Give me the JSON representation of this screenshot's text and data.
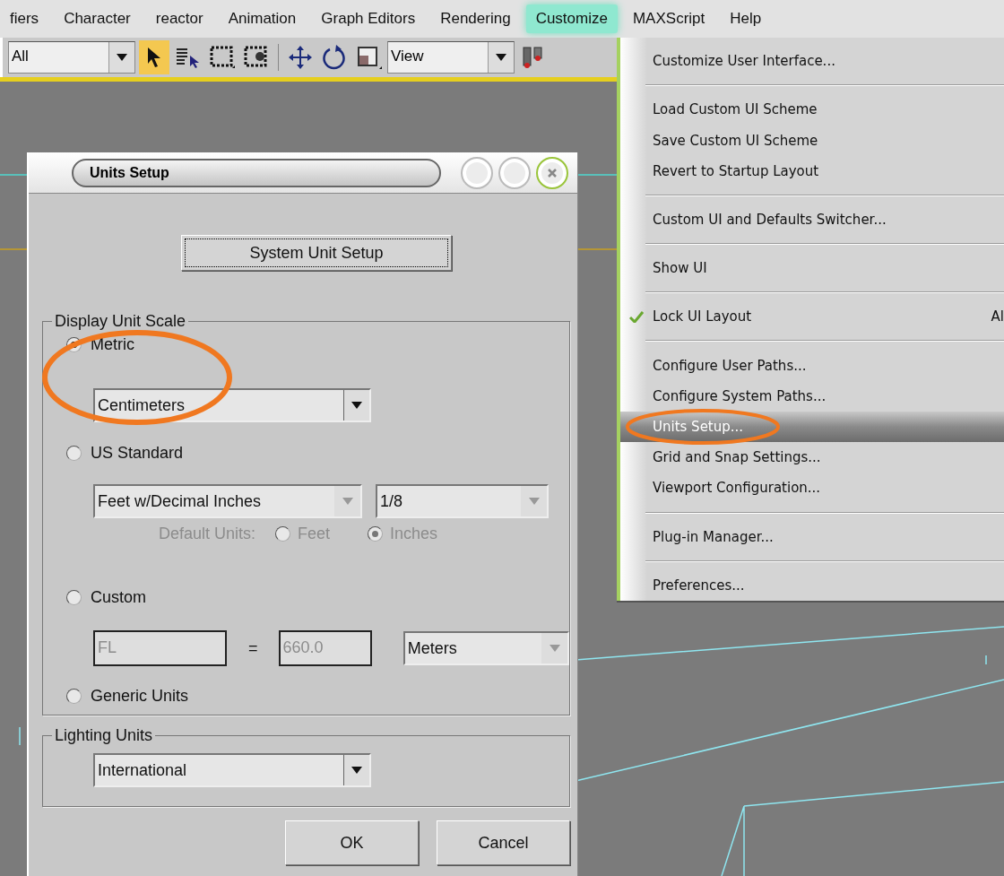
{
  "menu_bar": {
    "items": [
      {
        "label": "fiers",
        "selected": false
      },
      {
        "label": "Character",
        "selected": false
      },
      {
        "label": "reactor",
        "selected": false
      },
      {
        "label": "Animation",
        "selected": false
      },
      {
        "label": "Graph Editors",
        "selected": false
      },
      {
        "label": "Rendering",
        "selected": false
      },
      {
        "label": "Customize",
        "selected": true
      },
      {
        "label": "MAXScript",
        "selected": false
      },
      {
        "label": "Help",
        "selected": false
      }
    ]
  },
  "toolbar": {
    "items": [
      {
        "kind": "dropdown",
        "value": "All"
      },
      {
        "kind": "select",
        "active": true
      },
      {
        "kind": "select_by_name",
        "active": false
      },
      {
        "kind": "region",
        "active": false
      },
      {
        "kind": "window_crossing",
        "active": false
      },
      {
        "kind": "move",
        "active": false
      },
      {
        "kind": "rotate",
        "active": false
      },
      {
        "kind": "scale",
        "active": false
      },
      {
        "kind": "dropdown",
        "value": "View"
      },
      {
        "kind": "pivot",
        "active": false
      }
    ]
  },
  "menu": {
    "groups": [
      [
        {
          "label": "Customize User Interface...",
          "checked": false,
          "selected": false
        }
      ],
      [
        {
          "label": "Load Custom UI Scheme",
          "checked": false,
          "selected": false
        },
        {
          "label": "Save Custom UI Scheme",
          "checked": false,
          "selected": false
        },
        {
          "label": "Revert to Startup Layout",
          "checked": false,
          "selected": false
        }
      ],
      [
        {
          "label": "Custom UI and Defaults Switcher...",
          "checked": false,
          "selected": false
        }
      ],
      [
        {
          "label": "Show UI",
          "checked": false,
          "selected": false
        }
      ],
      [
        {
          "label": "Lock UI Layout",
          "checked": true,
          "selected": false,
          "shortcut": "Al"
        }
      ],
      [
        {
          "label": "Configure User Paths...",
          "checked": false,
          "selected": false
        },
        {
          "label": "Configure System Paths...",
          "checked": false,
          "selected": false
        },
        {
          "label": "Units Setup...",
          "checked": false,
          "selected": true
        },
        {
          "label": "Grid and Snap Settings...",
          "checked": false,
          "selected": false
        },
        {
          "label": "Viewport Configuration...",
          "checked": false,
          "selected": false
        }
      ],
      [
        {
          "label": "Plug-in Manager...",
          "checked": false,
          "selected": false
        }
      ],
      [
        {
          "label": "Preferences...",
          "checked": false,
          "selected": false
        }
      ]
    ]
  },
  "dialog": {
    "title": "Units Setup",
    "system_unit_button": "System Unit Setup",
    "display_unit_scale": {
      "title": "Display Unit Scale",
      "options": [
        {
          "kind": "metric",
          "label": "Metric",
          "selected": true,
          "unit": {
            "value": "Centimeters",
            "disabled": false
          }
        },
        {
          "kind": "us_standard",
          "label": "US Standard",
          "selected": false,
          "unit": {
            "value": "Feet w/Decimal Inches",
            "disabled": true
          },
          "fraction": {
            "value": "1/8",
            "disabled": true
          },
          "default_units": {
            "label": "Default Units:",
            "disabled": true,
            "choices": [
              {
                "label": "Feet",
                "selected": false
              },
              {
                "label": "Inches",
                "selected": true
              }
            ]
          }
        },
        {
          "kind": "custom",
          "label": "Custom",
          "selected": false,
          "name": {
            "value": "FL",
            "disabled": true
          },
          "equals": "=",
          "amount": {
            "value": "660.0",
            "disabled": true
          },
          "unit": {
            "value": "Meters",
            "disabled": true
          }
        },
        {
          "kind": "generic",
          "label": "Generic Units",
          "selected": false
        }
      ]
    },
    "lighting_units": {
      "title": "Lighting Units",
      "unit": {
        "value": "International",
        "disabled": false
      }
    },
    "buttons": [
      "OK",
      "Cancel"
    ]
  }
}
